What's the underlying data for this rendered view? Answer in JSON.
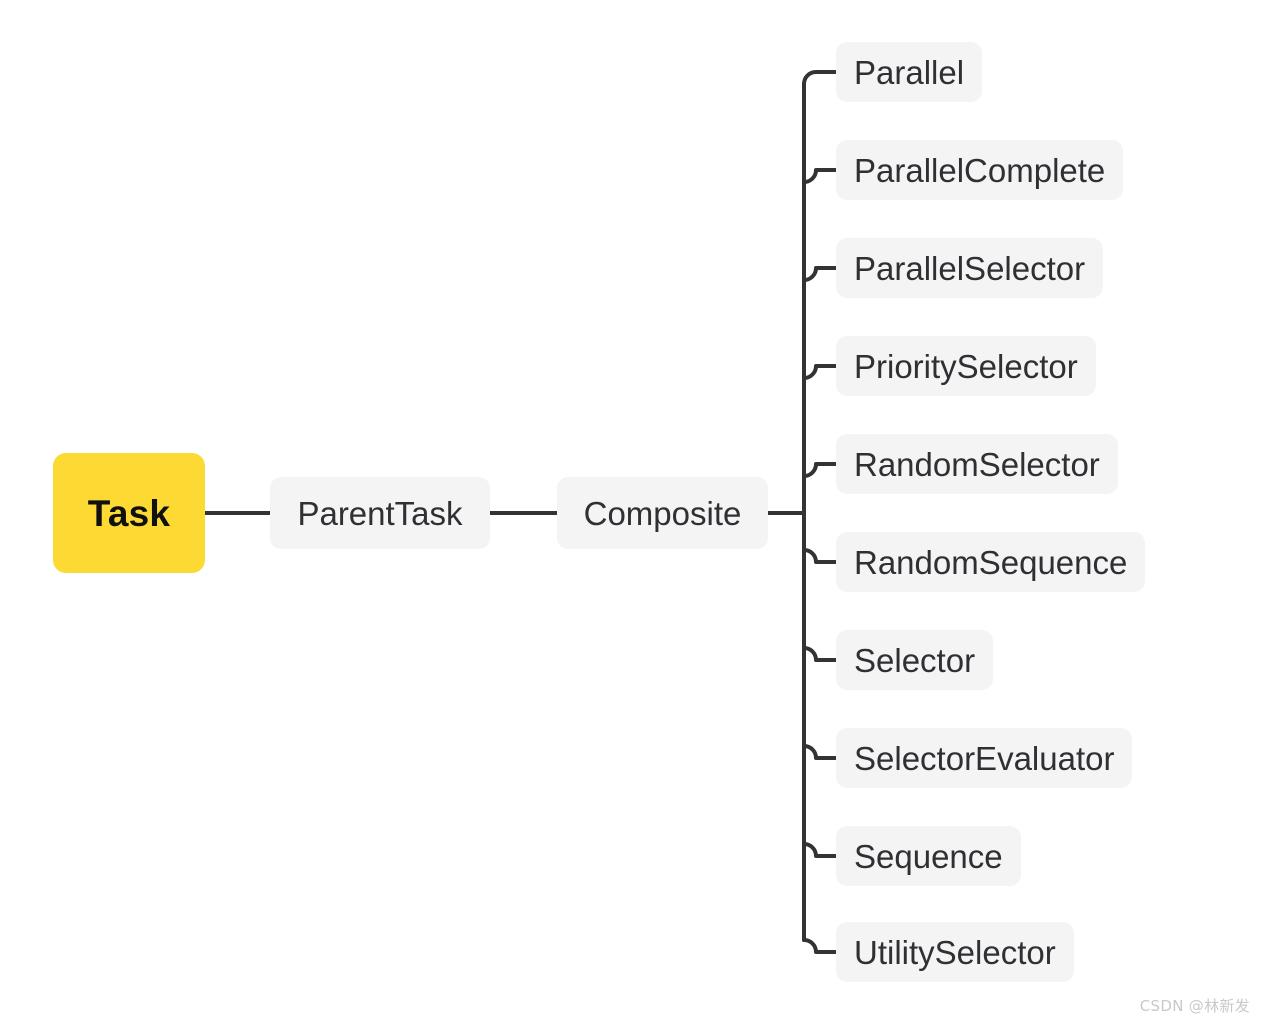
{
  "diagram": {
    "type": "mindmap-tree",
    "orientation": "left-to-right",
    "background_color": "#ffffff",
    "connector_color": "#333333",
    "connector_width": 4,
    "root": {
      "label": "Task",
      "fill": "#fcd933",
      "text_color": "#101010",
      "bold": true
    },
    "branches": [
      {
        "label": "ParentTask",
        "fill": "#f4f4f5",
        "text_color": "#2f3033"
      },
      {
        "label": "Composite",
        "fill": "#f4f4f5",
        "text_color": "#2f3033"
      }
    ],
    "leaves": [
      {
        "label": "Parallel"
      },
      {
        "label": "ParallelComplete"
      },
      {
        "label": "ParallelSelector"
      },
      {
        "label": "PrioritySelector"
      },
      {
        "label": "RandomSelector"
      },
      {
        "label": "RandomSequence"
      },
      {
        "label": "Selector"
      },
      {
        "label": "SelectorEvaluator"
      },
      {
        "label": "Sequence"
      },
      {
        "label": "UtilitySelector"
      }
    ]
  },
  "watermark": {
    "text": "CSDN @林新发"
  }
}
